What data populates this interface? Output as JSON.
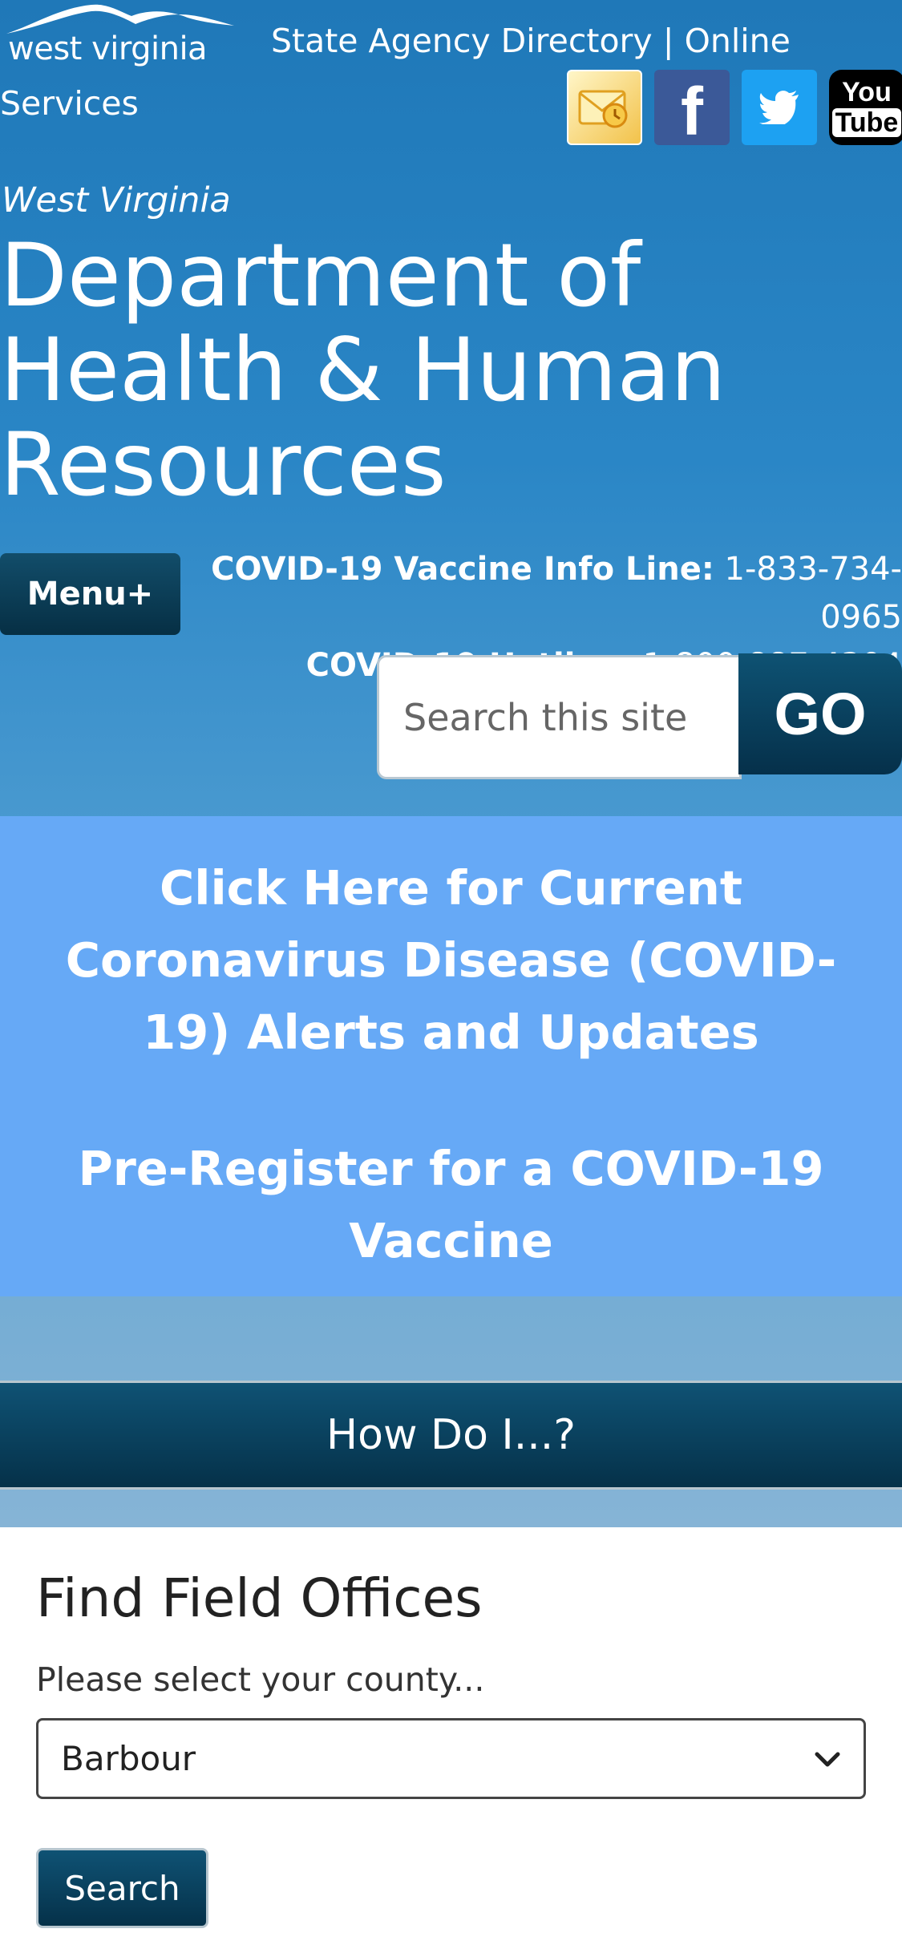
{
  "header": {
    "logo_text": "west virginia",
    "agency_directory": "State Agency Directory",
    "separator": "|",
    "online_services": "Online Services",
    "social_icons": [
      "email-icon",
      "facebook-icon",
      "twitter-icon",
      "youtube-icon"
    ]
  },
  "department": {
    "state": "West Virginia",
    "title": "Department of Health & Human Resources"
  },
  "menu": {
    "label": "Menu+"
  },
  "hotlines": {
    "vaccine_label": "COVID-19 Vaccine Info Line:",
    "vaccine_number": "1-833-734-0965",
    "hotline_label": "COVID-19 Hotline:",
    "hotline_number": "1-800-887-4304"
  },
  "search": {
    "placeholder": "Search this site",
    "button": "GO"
  },
  "covid": {
    "alerts_link": "Click Here for Current Coronavirus Disease (COVID-19) Alerts and Updates",
    "preregister_link": "Pre-Register for a COVID-19 Vaccine"
  },
  "howdo": {
    "label": "How Do I...?"
  },
  "field_offices": {
    "title": "Find Field Offices",
    "prompt": "Please select your county...",
    "selected_county": "Barbour",
    "search_button": "Search"
  },
  "colors": {
    "covid_box": "#66a9f6",
    "dark_button": "#0a3d57",
    "header_blue": "#1f78b8"
  }
}
